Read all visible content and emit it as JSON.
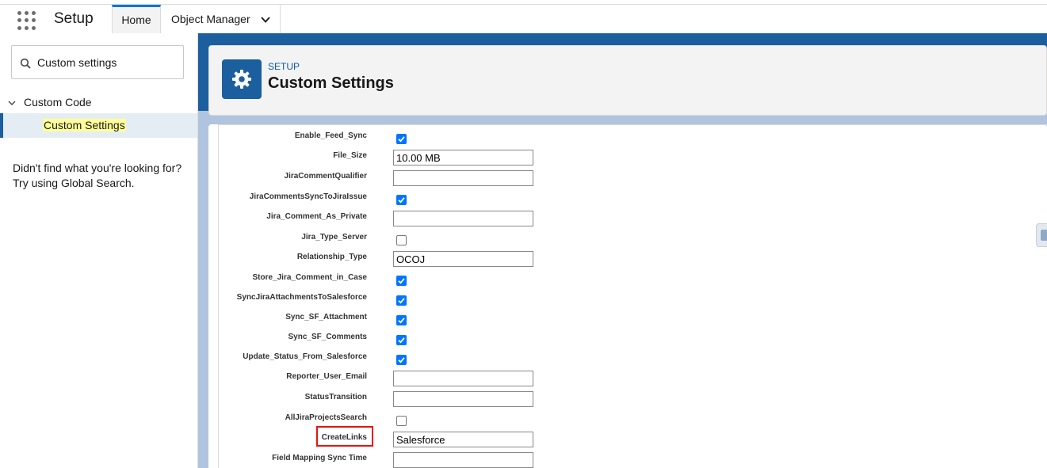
{
  "topnav": {
    "app_name": "Setup",
    "tabs": [
      {
        "label": "Home"
      },
      {
        "label": "Object Manager"
      }
    ]
  },
  "sidebar": {
    "search": {
      "value": "Custom settings"
    },
    "tree": {
      "parent_label": "Custom Code",
      "child_label": "Custom Settings"
    },
    "help_line1": "Didn't find what you're looking for?",
    "help_line2": "Try using Global Search."
  },
  "header": {
    "breadcrumb": "SETUP",
    "title": "Custom Settings"
  },
  "fields": [
    {
      "label": "Enable_Feed_Sync",
      "type": "checkbox",
      "checked": true
    },
    {
      "label": "File_Size",
      "type": "text",
      "value": "10.00 MB"
    },
    {
      "label": "JiraCommentQualifier",
      "type": "text",
      "value": ""
    },
    {
      "label": "JiraCommentsSyncToJiraIssue",
      "type": "checkbox",
      "checked": true
    },
    {
      "label": "Jira_Comment_As_Private",
      "type": "text",
      "value": ""
    },
    {
      "label": "Jira_Type_Server",
      "type": "checkbox",
      "checked": false
    },
    {
      "label": "Relationship_Type",
      "type": "text",
      "value": "OCOJ"
    },
    {
      "label": "Store_Jira_Comment_in_Case",
      "type": "checkbox",
      "checked": true
    },
    {
      "label": "SyncJiraAttachmentsToSalesforce",
      "type": "checkbox",
      "checked": true
    },
    {
      "label": "Sync_SF_Attachment",
      "type": "checkbox",
      "checked": true
    },
    {
      "label": "Sync_SF_Comments",
      "type": "checkbox",
      "checked": true
    },
    {
      "label": "Update_Status_From_Salesforce",
      "type": "checkbox",
      "checked": true
    },
    {
      "label": "Reporter_User_Email",
      "type": "text",
      "value": ""
    },
    {
      "label": "StatusTransition",
      "type": "text",
      "value": ""
    },
    {
      "label": "AllJiraProjectsSearch",
      "type": "checkbox",
      "checked": false
    },
    {
      "label": "CreateLinks",
      "type": "text",
      "value": "Salesforce"
    },
    {
      "label": "Field Mapping Sync Time",
      "type": "text",
      "value": ""
    }
  ]
}
